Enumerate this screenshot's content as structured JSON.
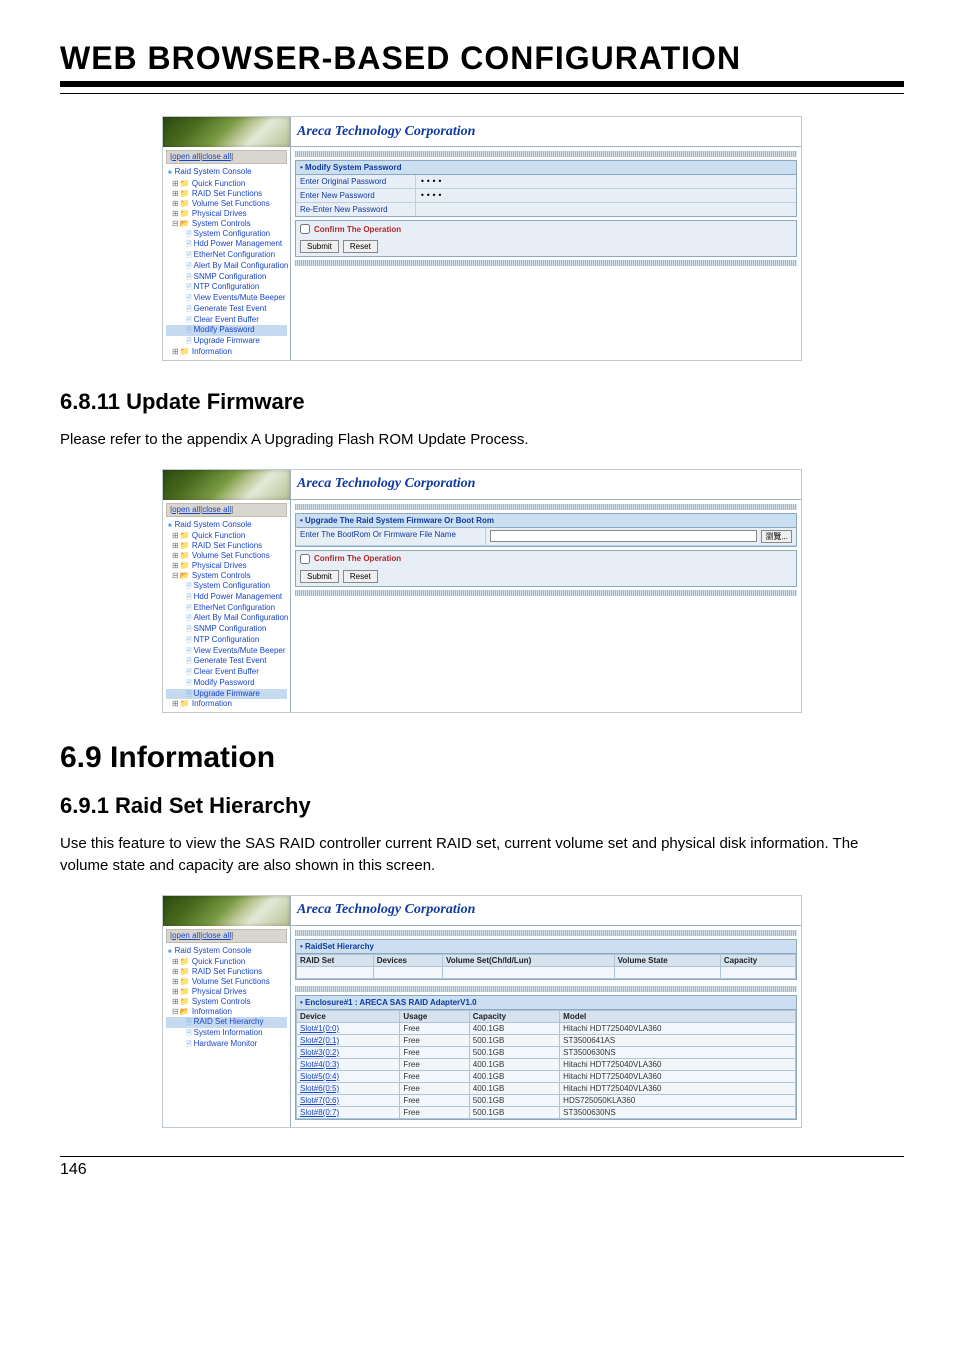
{
  "page": {
    "header": "WEB BROWSER-BASED CONFIGURATION",
    "footer_page": "146"
  },
  "brand": "Areca Technology Corporation",
  "tree_bar": {
    "open": "open all",
    "close": "close all"
  },
  "tree": {
    "root": "Raid System Console",
    "quick": "Quick Function",
    "raidset": "RAID Set Functions",
    "volset": "Volume Set Functions",
    "physical": "Physical Drives",
    "syscontrols": "System Controls",
    "leaves": {
      "sysconf": "System Configuration",
      "hdd": "Hdd Power Management",
      "ether": "EtherNet Configuration",
      "alert": "Alert By Mail Configuration",
      "snmp": "SNMP Configuration",
      "ntp": "NTP Configuration",
      "view": "View Events/Mute Beeper",
      "gentest": "Generate Test Event",
      "clear": "Clear Event Buffer",
      "modpw": "Modify Password",
      "upfw": "Upgrade Firmware"
    },
    "info": "Information",
    "info_leaves": {
      "raidhier": "RAID Set Hierarchy",
      "sysinfo": "System Information",
      "hwmon": "Hardware Monitor"
    }
  },
  "shot1": {
    "title": "• Modify System Password",
    "rows": {
      "orig": "Enter Original Password",
      "new": "Enter New Password",
      "re": "Re-Enter New Password"
    },
    "mask": "••••",
    "confirm": "Confirm The Operation",
    "submit": "Submit",
    "reset": "Reset"
  },
  "sec_6811": {
    "heading": "6.8.11 Update Firmware",
    "body": "Please refer to the appendix A Upgrading Flash ROM Update Process."
  },
  "shot2": {
    "title": "• Upgrade The Raid System Firmware Or Boot Rom",
    "file_label": "Enter The BootRom Or Firmware File Name",
    "browse": "瀏覽...",
    "confirm": "Confirm The Operation",
    "submit": "Submit",
    "reset": "Reset"
  },
  "sec_69": {
    "heading": "6.9 Information"
  },
  "sec_691": {
    "heading": "6.9.1 Raid Set Hierarchy",
    "body": "Use this feature to view the SAS RAID controller current RAID set, current volume set and physical disk information. The volume state and capacity are also shown in this screen."
  },
  "shot3": {
    "hier_title": "• RaidSet Hierarchy",
    "hier_cols": {
      "raidset": "RAID Set",
      "devices": "Devices",
      "volset": "Volume Set(Ch/Id/Lun)",
      "volstate": "Volume State",
      "capacity": "Capacity"
    },
    "enc_title": "• Enclosure#1 : ARECA SAS RAID AdapterV1.0",
    "enc_cols": {
      "device": "Device",
      "usage": "Usage",
      "capacity": "Capacity",
      "model": "Model"
    },
    "enc_rows": [
      {
        "device": "Slot#1(0:0)",
        "usage": "Free",
        "capacity": "400.1GB",
        "model": "Hitachi HDT725040VLA360"
      },
      {
        "device": "Slot#2(0:1)",
        "usage": "Free",
        "capacity": "500.1GB",
        "model": "ST3500641AS"
      },
      {
        "device": "Slot#3(0:2)",
        "usage": "Free",
        "capacity": "500.1GB",
        "model": "ST3500630NS"
      },
      {
        "device": "Slot#4(0:3)",
        "usage": "Free",
        "capacity": "400.1GB",
        "model": "Hitachi HDT725040VLA360"
      },
      {
        "device": "Slot#5(0:4)",
        "usage": "Free",
        "capacity": "400.1GB",
        "model": "Hitachi HDT725040VLA360"
      },
      {
        "device": "Slot#6(0:5)",
        "usage": "Free",
        "capacity": "400.1GB",
        "model": "Hitachi HDT725040VLA360"
      },
      {
        "device": "Slot#7(0:6)",
        "usage": "Free",
        "capacity": "500.1GB",
        "model": "HDS725050KLA360"
      },
      {
        "device": "Slot#8(0:7)",
        "usage": "Free",
        "capacity": "500.1GB",
        "model": "ST3500630NS"
      }
    ]
  },
  "chart_data": {
    "type": "table",
    "title": "Enclosure#1 : ARECA SAS RAID AdapterV1.0",
    "columns": [
      "Device",
      "Usage",
      "Capacity",
      "Model"
    ],
    "rows": [
      [
        "Slot#1(0:0)",
        "Free",
        "400.1GB",
        "Hitachi HDT725040VLA360"
      ],
      [
        "Slot#2(0:1)",
        "Free",
        "500.1GB",
        "ST3500641AS"
      ],
      [
        "Slot#3(0:2)",
        "Free",
        "500.1GB",
        "ST3500630NS"
      ],
      [
        "Slot#4(0:3)",
        "Free",
        "400.1GB",
        "Hitachi HDT725040VLA360"
      ],
      [
        "Slot#5(0:4)",
        "Free",
        "400.1GB",
        "Hitachi HDT725040VLA360"
      ],
      [
        "Slot#6(0:5)",
        "Free",
        "400.1GB",
        "Hitachi HDT725040VLA360"
      ],
      [
        "Slot#7(0:6)",
        "Free",
        "500.1GB",
        "HDS725050KLA360"
      ],
      [
        "Slot#8(0:7)",
        "Free",
        "500.1GB",
        "ST3500630NS"
      ]
    ]
  }
}
